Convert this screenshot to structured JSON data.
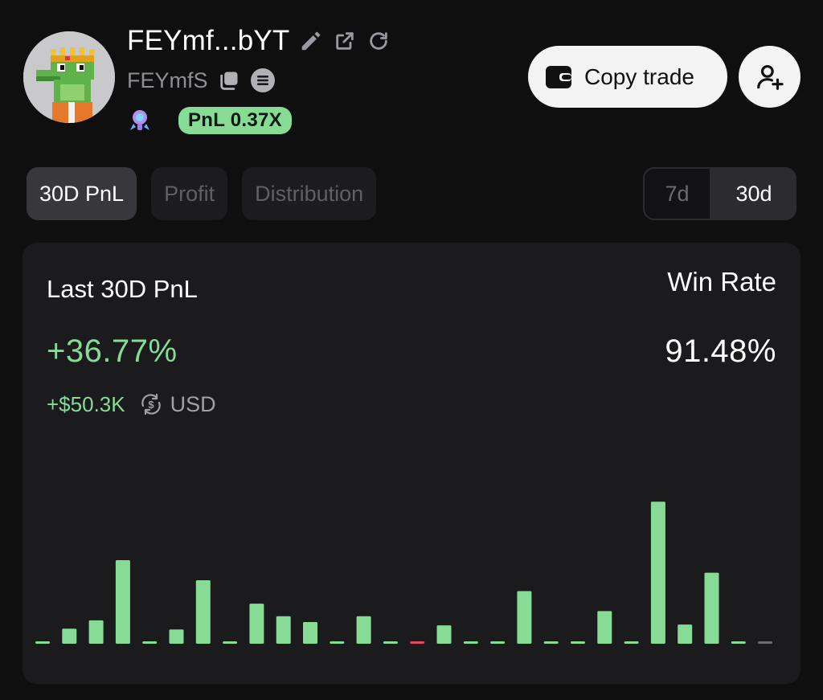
{
  "profile": {
    "title": "FEYmf...bYT",
    "subname": "FEYmfS",
    "pnl_badge": "PnL 0.37X",
    "icons": [
      "edit-icon",
      "external-link-icon",
      "refresh-icon",
      "copy-icon",
      "solana-icon",
      "rocket-icon"
    ]
  },
  "actions": {
    "copy_trade": "Copy trade",
    "follow_icon": "add-user-icon"
  },
  "tabs": [
    {
      "label": "30D PnL",
      "active": true
    },
    {
      "label": "Profit",
      "active": false
    },
    {
      "label": "Distribution",
      "active": false
    }
  ],
  "range": {
    "options": [
      {
        "label": "7d",
        "active": false
      },
      {
        "label": "30d",
        "active": true
      }
    ]
  },
  "summary": {
    "label": "Last 30D PnL",
    "pnl_percent": "+36.77%",
    "pnl_usd": "+$50.3K",
    "currency": "USD",
    "win_rate_label": "Win Rate",
    "win_rate": "91.48%"
  },
  "colors": {
    "positive": "#86db95",
    "negative": "#e5485d",
    "neutral": "#6b6b73"
  },
  "chart_data": {
    "type": "bar",
    "title": "",
    "xlabel": "",
    "ylabel": "",
    "grid": false,
    "values": [
      0,
      18,
      28,
      100,
      0,
      17,
      76,
      0,
      48,
      33,
      26,
      0,
      33,
      0,
      -1,
      22,
      0,
      0,
      63,
      0,
      0,
      39,
      0,
      170,
      23,
      85,
      0,
      0
    ],
    "ylim": [
      -5,
      175
    ]
  }
}
